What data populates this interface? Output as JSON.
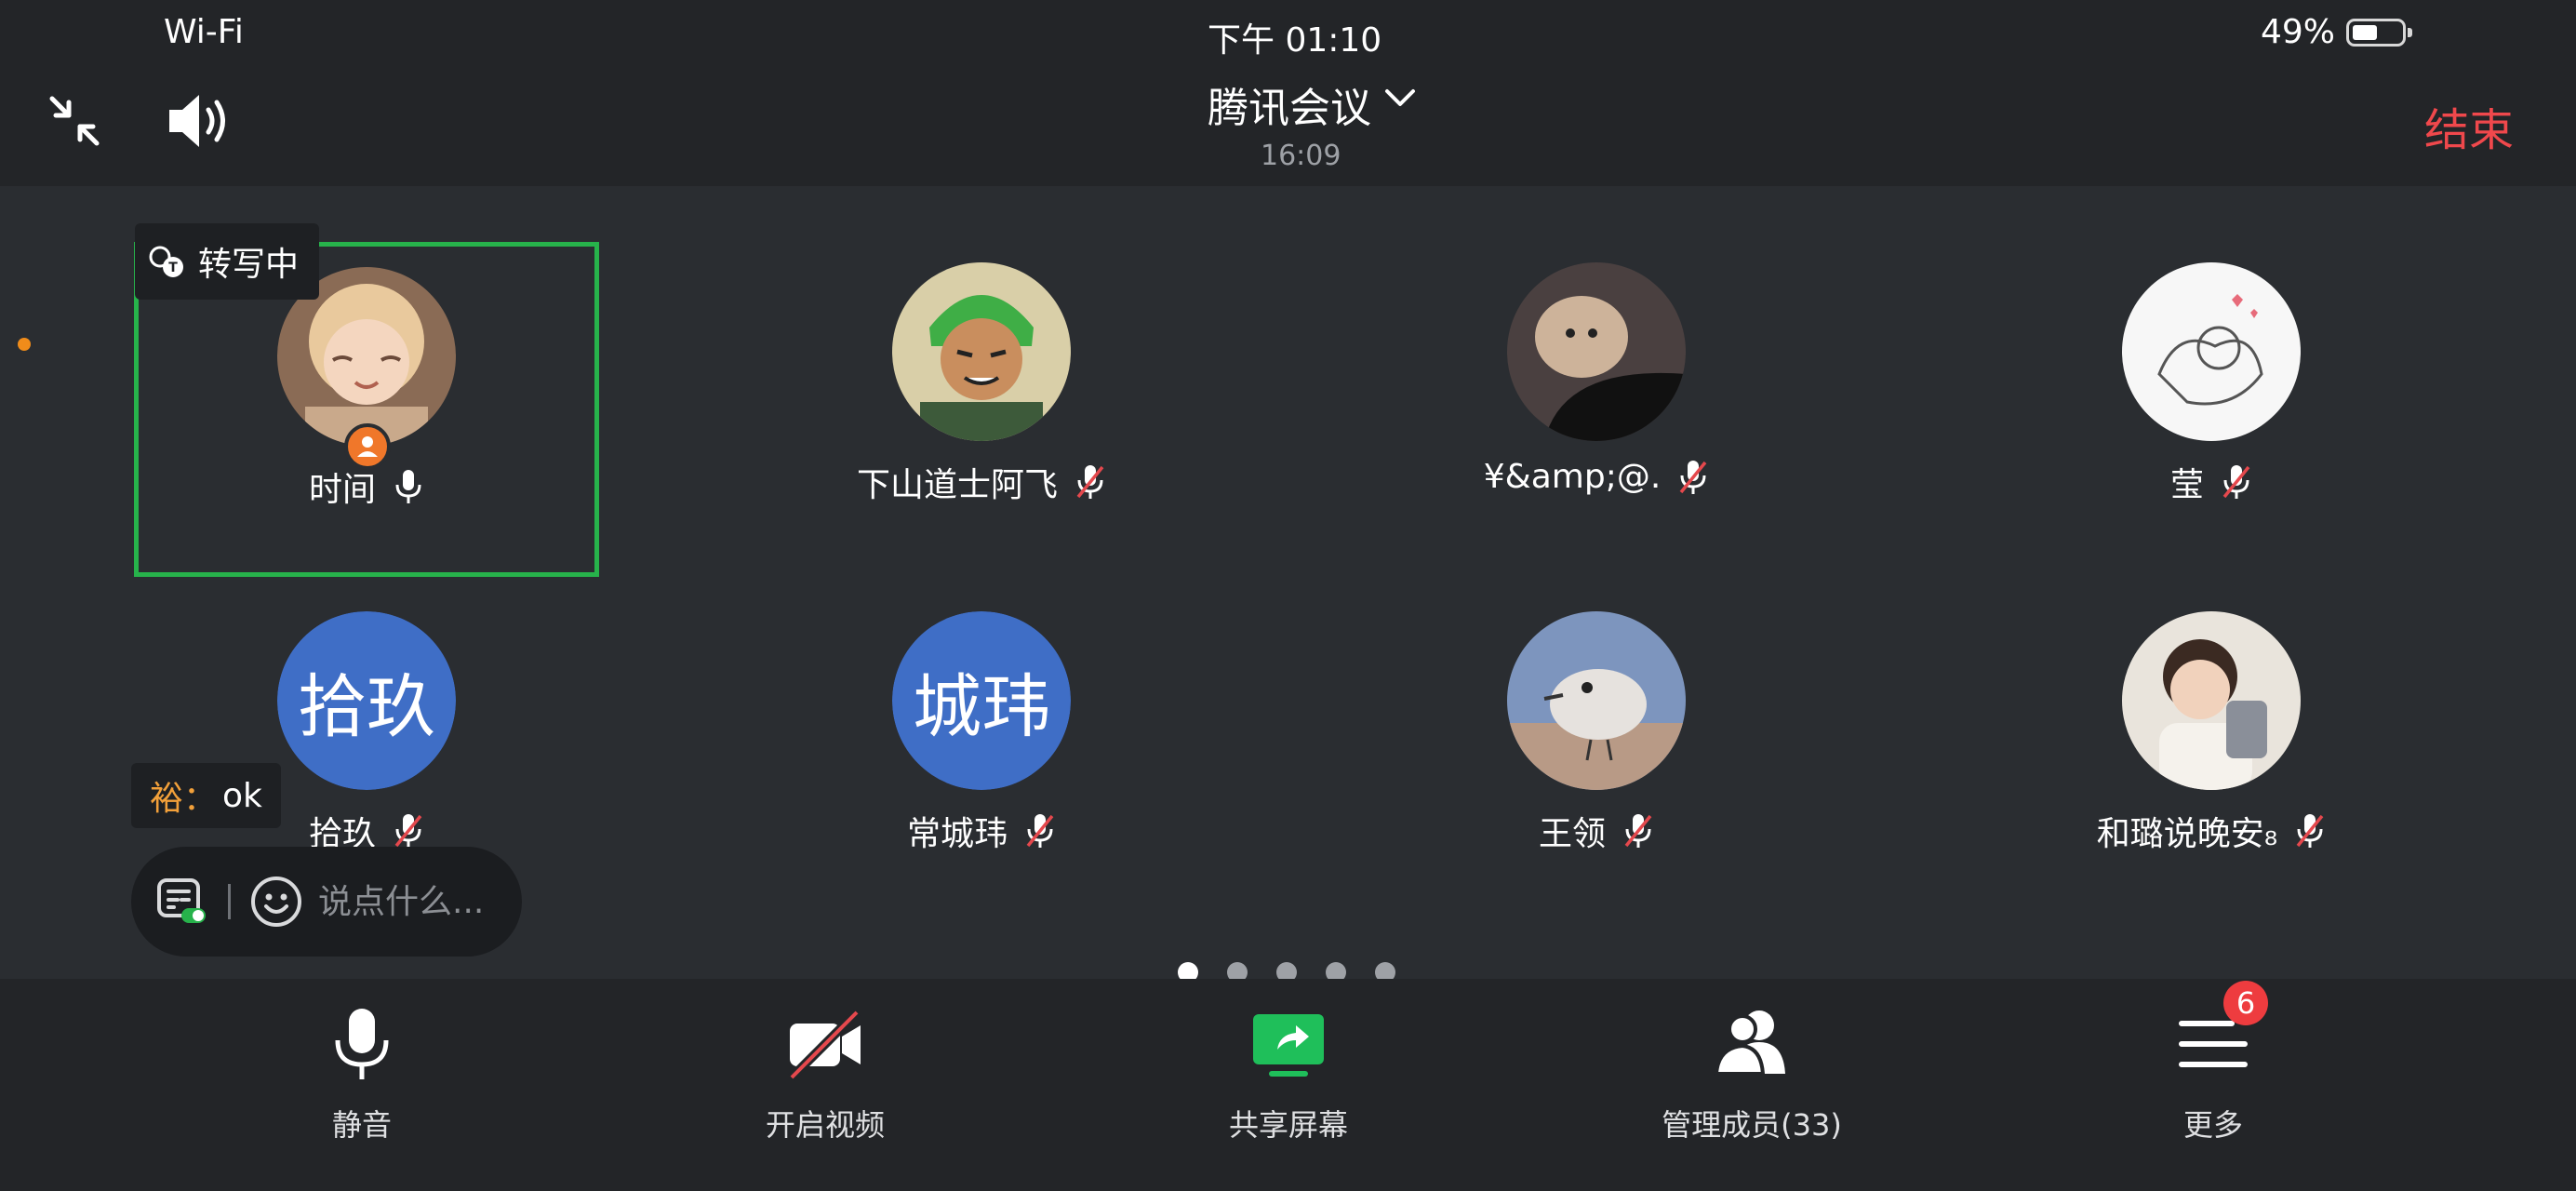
{
  "status_bar": {
    "network": "Wi-Fi",
    "time": "下午 01:10",
    "battery": "49%",
    "battery_level": 0.49
  },
  "header": {
    "title": "腾讯会议",
    "duration": "16:09",
    "end_label": "结束"
  },
  "transcription": {
    "label": "转写中"
  },
  "participants": [
    {
      "name": "时间",
      "mic": "on",
      "host": true,
      "active_speaker": true,
      "avatar": "photo-child"
    },
    {
      "name": "下山道士阿飞",
      "mic": "muted",
      "avatar": "photo-anime"
    },
    {
      "name": "¥&amp;@.",
      "mic": "muted",
      "avatar": "photo-dog"
    },
    {
      "name": "莹",
      "mic": "muted",
      "avatar": "photo-sketch"
    },
    {
      "name": "拾玖",
      "mic": "muted",
      "initials": "拾玖"
    },
    {
      "name": "常城玮",
      "mic": "muted",
      "initials": "城玮"
    },
    {
      "name": "王领",
      "mic": "muted",
      "avatar": "photo-bird"
    },
    {
      "name": "和璐说晚安₈",
      "mic": "muted",
      "avatar": "photo-girl"
    }
  ],
  "chat": {
    "sender": "裕：",
    "message": "ok",
    "input_placeholder": "说点什么..."
  },
  "pager": {
    "pages": 5,
    "current": 1
  },
  "toolbar": {
    "mute": "静音",
    "video": "开启视频",
    "share": "共享屏幕",
    "members": "管理成员(33)",
    "more": "更多",
    "more_badge": "6"
  },
  "colors": {
    "background": "#2a2d31",
    "bar": "#232528",
    "active_speaker_border": "#27b24b",
    "end_button": "#f0484c",
    "share_green": "#1fbf5a",
    "initials_avatar": "#3f6ec6",
    "badge_red": "#ee3c3f"
  }
}
